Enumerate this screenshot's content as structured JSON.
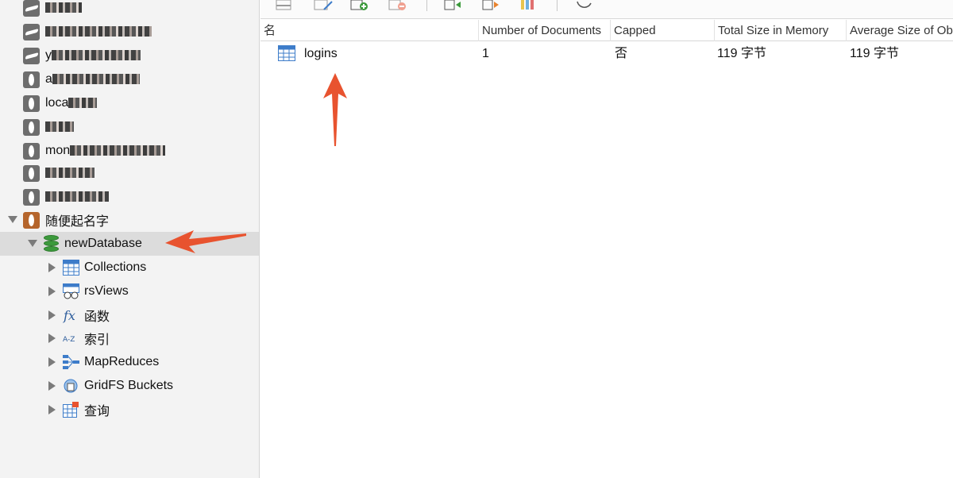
{
  "sidebar": {
    "connections": [
      {
        "label": "",
        "icon": "mongodb-shark-icon"
      },
      {
        "label": "",
        "icon": "mongodb-shark-icon"
      },
      {
        "label": "y",
        "icon": "mongodb-shark-icon"
      },
      {
        "label": "a",
        "icon": "mongodb-leaf-icon"
      },
      {
        "label": "loca",
        "icon": "mongodb-leaf-icon"
      },
      {
        "label": "",
        "icon": "mongodb-leaf-icon"
      },
      {
        "label": "mon",
        "icon": "mongodb-leaf-icon"
      },
      {
        "label": "",
        "icon": "mongodb-leaf-icon"
      },
      {
        "label": "",
        "icon": "mongodb-leaf-icon"
      },
      {
        "label": "随便起名字",
        "icon": "mongodb-leaf-icon"
      }
    ],
    "database": {
      "label": "newDatabase",
      "icon": "database-icon"
    },
    "children": [
      {
        "label": "Collections",
        "icon": "table-grid-icon"
      },
      {
        "label": "rsViews",
        "icon": "views-icon"
      },
      {
        "label": "函数",
        "icon": "function-icon"
      },
      {
        "label": "索引",
        "icon": "index-icon"
      },
      {
        "label": "MapReduces",
        "icon": "mapreduce-icon"
      },
      {
        "label": "GridFS Buckets",
        "icon": "gridfs-icon"
      },
      {
        "label": "查询",
        "icon": "query-icon"
      }
    ]
  },
  "table": {
    "columns": [
      "名",
      "Number of Documents",
      "Capped",
      "Total Size in Memory",
      "Average Size of Ob"
    ],
    "rows": [
      {
        "name": "logins",
        "documents": "1",
        "capped": "否",
        "total_size": "119 字节",
        "avg_size": "119 字节"
      }
    ]
  },
  "colors": {
    "accent_arrow": "#e8532f",
    "db_green": "#3c9a3c",
    "selected_row": "#dcdcdc"
  }
}
